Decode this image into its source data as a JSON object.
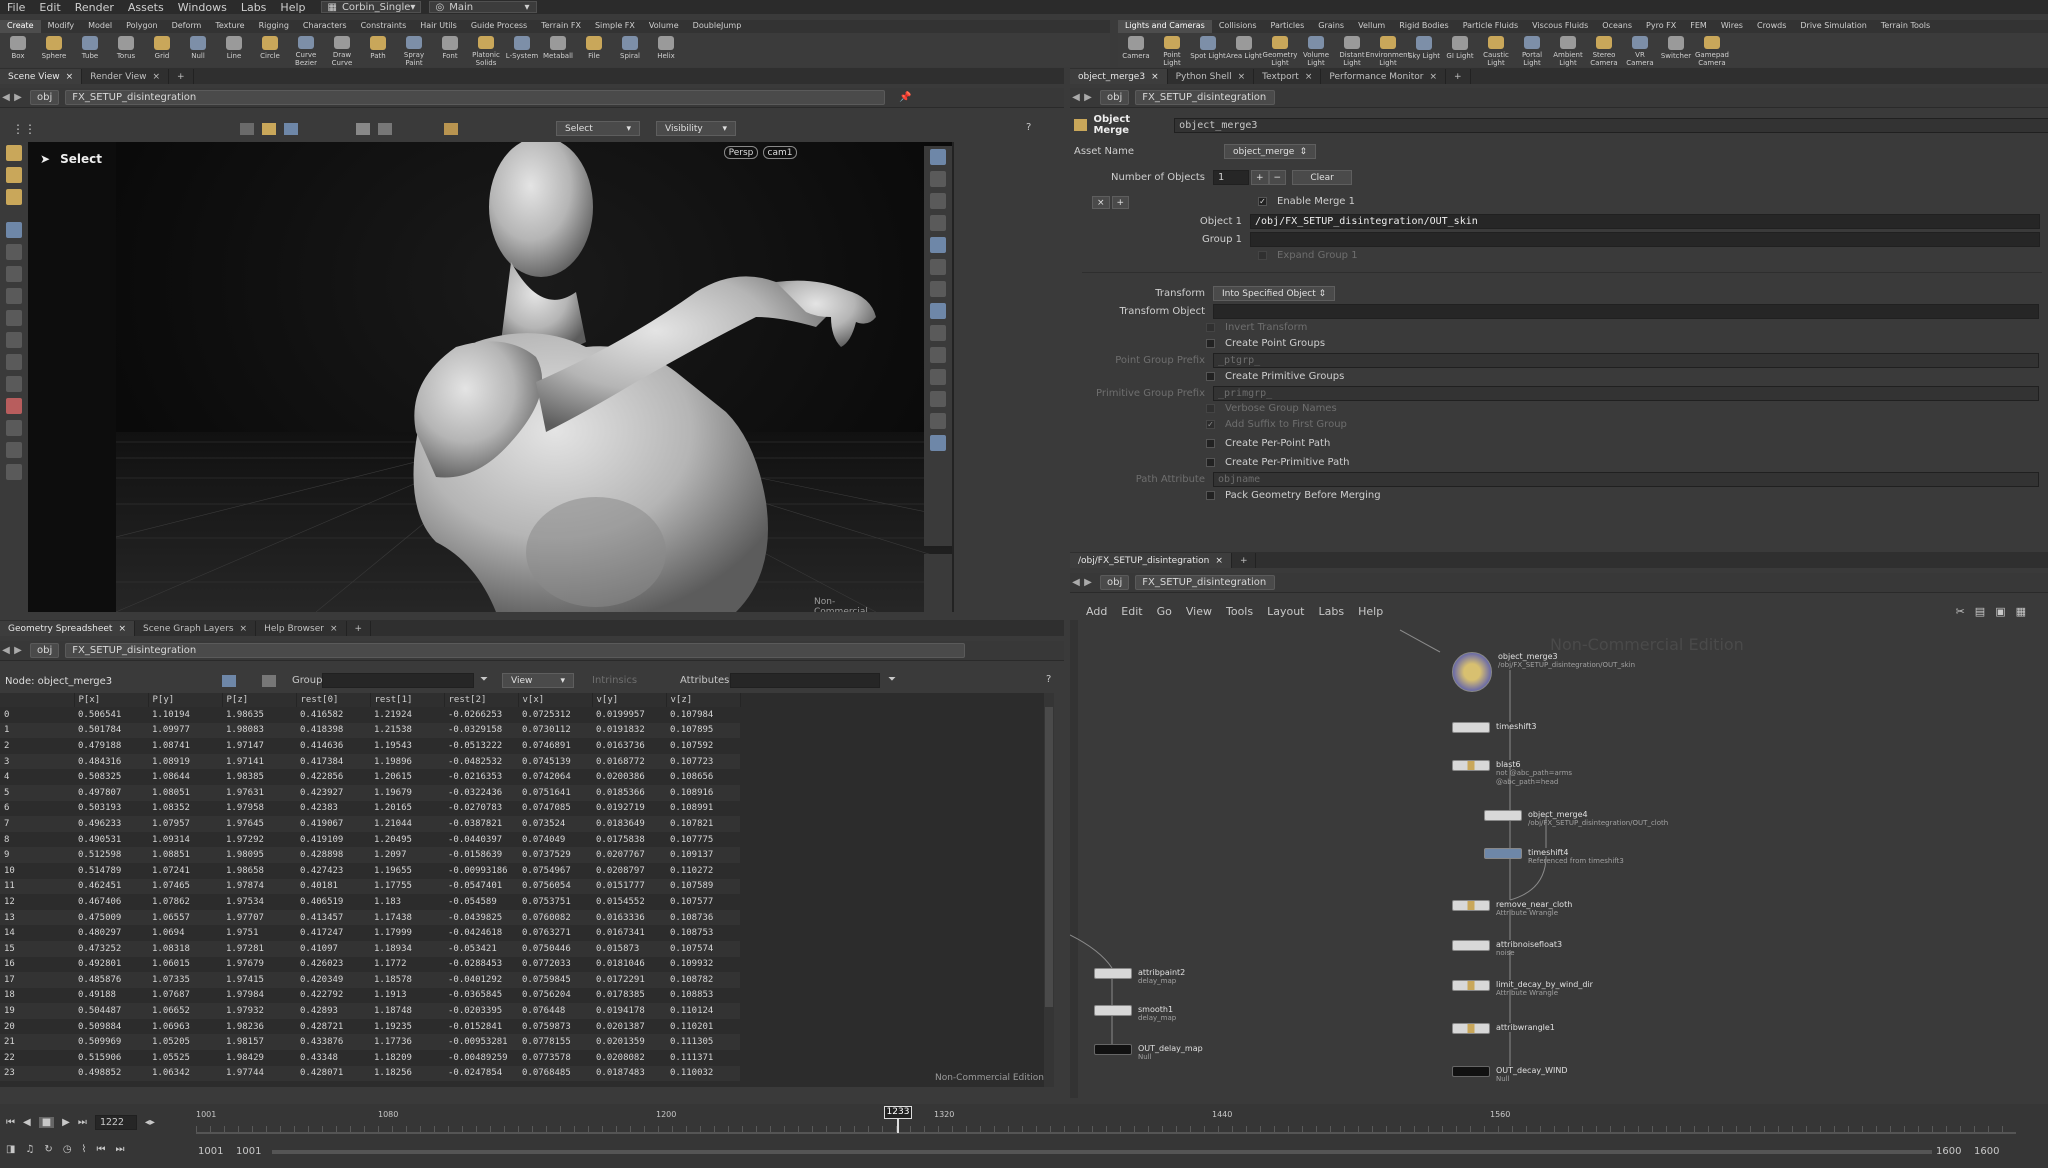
{
  "menubar": {
    "items": [
      "File",
      "Edit",
      "Render",
      "Assets",
      "Windows",
      "Labs",
      "Help"
    ],
    "desktop": "Corbin_Single",
    "context": "Main"
  },
  "shelf_left": {
    "tabs": [
      "Create",
      "Modify",
      "Model",
      "Polygon",
      "Deform",
      "Texture",
      "Rigging",
      "Characters",
      "Constraints",
      "Hair Utils",
      "Guide Process",
      "Terrain FX",
      "Simple FX",
      "Volume",
      "DoubleJump"
    ],
    "tools": [
      "Box",
      "Sphere",
      "Tube",
      "Torus",
      "Grid",
      "Null",
      "Line",
      "Circle",
      "Curve Bezier",
      "Draw Curve",
      "Path",
      "Spray Paint",
      "Font",
      "Platonic Solids",
      "L-System",
      "Metaball",
      "File",
      "Spiral",
      "Helix"
    ]
  },
  "shelf_right": {
    "tabs": [
      "Lights and Cameras",
      "Collisions",
      "Particles",
      "Grains",
      "Vellum",
      "Rigid Bodies",
      "Particle Fluids",
      "Viscous Fluids",
      "Oceans",
      "Pyro FX",
      "FEM",
      "Wires",
      "Crowds",
      "Drive Simulation",
      "Terrain Tools"
    ],
    "tools": [
      "Camera",
      "Point Light",
      "Spot Light",
      "Area Light",
      "Geometry Light",
      "Volume Light",
      "Distant Light",
      "Environment Light",
      "Sky Light",
      "GI Light",
      "Caustic Light",
      "Portal Light",
      "Ambient Light",
      "Stereo Camera",
      "VR Camera",
      "Switcher",
      "Gamepad Camera"
    ]
  },
  "scene_view": {
    "tabs": [
      "Scene View",
      "Render View"
    ],
    "path_root": "obj",
    "path_node": "FX_SETUP_disintegration",
    "select_label": "Select",
    "select_mode": "Select",
    "visibility": "Visibility",
    "persp": "Persp",
    "cam": "cam1",
    "watermark": "Non-Commercial Edition"
  },
  "spreadsheet": {
    "tabs": [
      "Geometry Spreadsheet",
      "Scene Graph Layers",
      "Help Browser"
    ],
    "path_root": "obj",
    "path_node": "FX_SETUP_disintegration",
    "node_label": "Node: object_merge3",
    "group_label": "Group:",
    "view": "View",
    "intrinsics": "Intrinsics",
    "attributes_label": "Attributes:",
    "columns": [
      "",
      "P[x]",
      "P[y]",
      "P[z]",
      "rest[0]",
      "rest[1]",
      "rest[2]",
      "v[x]",
      "v[y]",
      "v[z]"
    ],
    "rows": [
      [
        "0",
        "0.506541",
        "1.10194",
        "1.98635",
        "0.416582",
        "1.21924",
        "-0.0266253",
        "0.0725312",
        "0.0199957",
        "0.107984"
      ],
      [
        "1",
        "0.501784",
        "1.09977",
        "1.98083",
        "0.418398",
        "1.21538",
        "-0.0329158",
        "0.0730112",
        "0.0191832",
        "0.107895"
      ],
      [
        "2",
        "0.479188",
        "1.08741",
        "1.97147",
        "0.414636",
        "1.19543",
        "-0.0513222",
        "0.0746891",
        "0.0163736",
        "0.107592"
      ],
      [
        "3",
        "0.484316",
        "1.08919",
        "1.97141",
        "0.417384",
        "1.19896",
        "-0.0482532",
        "0.0745139",
        "0.0168772",
        "0.107723"
      ],
      [
        "4",
        "0.508325",
        "1.08644",
        "1.98385",
        "0.422856",
        "1.20615",
        "-0.0216353",
        "0.0742064",
        "0.0200386",
        "0.108656"
      ],
      [
        "5",
        "0.497807",
        "1.08051",
        "1.97631",
        "0.423927",
        "1.19679",
        "-0.0322436",
        "0.0751641",
        "0.0185366",
        "0.108916"
      ],
      [
        "6",
        "0.503193",
        "1.08352",
        "1.97958",
        "0.42383",
        "1.20165",
        "-0.0270783",
        "0.0747085",
        "0.0192719",
        "0.108991"
      ],
      [
        "7",
        "0.496233",
        "1.07957",
        "1.97645",
        "0.419067",
        "1.21044",
        "-0.0387821",
        "0.073524",
        "0.0183649",
        "0.107821"
      ],
      [
        "8",
        "0.490531",
        "1.09314",
        "1.97292",
        "0.419109",
        "1.20495",
        "-0.0440397",
        "0.074049",
        "0.0175838",
        "0.107775"
      ],
      [
        "9",
        "0.512598",
        "1.08851",
        "1.98095",
        "0.428898",
        "1.2097",
        "-0.0158639",
        "0.0737529",
        "0.0207767",
        "0.109137"
      ],
      [
        "10",
        "0.514789",
        "1.07241",
        "1.98658",
        "0.427423",
        "1.19655",
        "-0.00993186",
        "0.0754967",
        "0.0208797",
        "0.110272"
      ],
      [
        "11",
        "0.462451",
        "1.07465",
        "1.97874",
        "0.40181",
        "1.17755",
        "-0.0547401",
        "0.0756054",
        "0.0151777",
        "0.107589"
      ],
      [
        "12",
        "0.467406",
        "1.07862",
        "1.97534",
        "0.406519",
        "1.183",
        "-0.054589",
        "0.0753751",
        "0.0154552",
        "0.107577"
      ],
      [
        "13",
        "0.475009",
        "1.06557",
        "1.97707",
        "0.413457",
        "1.17438",
        "-0.0439825",
        "0.0760082",
        "0.0163336",
        "0.108736"
      ],
      [
        "14",
        "0.480297",
        "1.0694",
        "1.9751",
        "0.417247",
        "1.17999",
        "-0.0424618",
        "0.0763271",
        "0.0167341",
        "0.108753"
      ],
      [
        "15",
        "0.473252",
        "1.08318",
        "1.97281",
        "0.41097",
        "1.18934",
        "-0.053421",
        "0.0750446",
        "0.015873",
        "0.107574"
      ],
      [
        "16",
        "0.492801",
        "1.06015",
        "1.97679",
        "0.426023",
        "1.1772",
        "-0.0288453",
        "0.0772033",
        "0.0181046",
        "0.109932"
      ],
      [
        "17",
        "0.485876",
        "1.07335",
        "1.97415",
        "0.420349",
        "1.18578",
        "-0.0401292",
        "0.0759845",
        "0.0172291",
        "0.108782"
      ],
      [
        "18",
        "0.49188",
        "1.07687",
        "1.97984",
        "0.422792",
        "1.1913",
        "-0.0365845",
        "0.0756204",
        "0.0178385",
        "0.108853"
      ],
      [
        "19",
        "0.504487",
        "1.06652",
        "1.97932",
        "0.42893",
        "1.18748",
        "-0.0203395",
        "0.076448",
        "0.0194178",
        "0.110124"
      ],
      [
        "20",
        "0.509884",
        "1.06963",
        "1.98236",
        "0.428721",
        "1.19235",
        "-0.0152841",
        "0.0759873",
        "0.0201387",
        "0.110201"
      ],
      [
        "21",
        "0.509969",
        "1.05205",
        "1.98157",
        "0.433876",
        "1.17736",
        "-0.00953281",
        "0.0778155",
        "0.0201359",
        "0.111305"
      ],
      [
        "22",
        "0.515906",
        "1.05525",
        "1.98429",
        "0.43348",
        "1.18209",
        "-0.00489259",
        "0.0773578",
        "0.0208082",
        "0.111371"
      ],
      [
        "23",
        "0.498852",
        "1.06342",
        "1.97744",
        "0.428071",
        "1.18256",
        "-0.0247854",
        "0.0768485",
        "0.0187483",
        "0.110032"
      ]
    ],
    "watermark": "Non-Commercial Edition"
  },
  "params": {
    "tabs": [
      "object_merge3",
      "Python Shell",
      "Textport",
      "Performance Monitor"
    ],
    "path_root": "obj",
    "path_node": "FX_SETUP_disintegration",
    "op_type": "Object Merge",
    "op_name": "object_merge3",
    "asset_name_label": "Asset Name",
    "asset_name": "object_merge",
    "num_objects_label": "Number of Objects",
    "num_objects": "1",
    "clear": "Clear",
    "enable_merge": "Enable Merge 1",
    "object1_label": "Object 1",
    "object1": "/obj/FX_SETUP_disintegration/OUT_skin",
    "group1_label": "Group 1",
    "expand_group": "Expand Group 1",
    "transform_label": "Transform",
    "transform": "Into Specified Object",
    "transform_object_label": "Transform Object",
    "invert_transform": "Invert Transform",
    "create_point_groups": "Create Point Groups",
    "point_group_prefix_label": "Point Group Prefix",
    "point_group_prefix": "_ptgrp_",
    "create_prim_groups": "Create Primitive Groups",
    "prim_group_prefix_label": "Primitive Group Prefix",
    "prim_group_prefix": "_primgrp_",
    "verbose_group_names": "Verbose Group Names",
    "add_suffix": "Add Suffix to First Group",
    "per_point_path": "Create Per-Point Path",
    "per_prim_path": "Create Per-Primitive Path",
    "path_attribute_label": "Path Attribute",
    "path_attribute": "objname",
    "pack_geometry": "Pack Geometry Before Merging"
  },
  "network": {
    "tab": "/obj/FX_SETUP_disintegration",
    "path_root": "obj",
    "path_node": "FX_SETUP_disintegration",
    "menu": [
      "Add",
      "Edit",
      "Go",
      "View",
      "Tools",
      "Layout",
      "Labs",
      "Help"
    ],
    "watermark": "Non-Commercial Edition",
    "nodes": [
      {
        "name": "object_merge3",
        "sub": "/obj/FX_SETUP_disintegration/OUT_skin"
      },
      {
        "name": "timeshift3",
        "sub": ""
      },
      {
        "name": "blast6",
        "sub": "not @abc_path=arms @abc_path=head"
      },
      {
        "name": "object_merge4",
        "sub": "/obj/FX_SETUP_disintegration/OUT_cloth"
      },
      {
        "name": "timeshift4",
        "sub": "Referenced from timeshift3"
      },
      {
        "name": "remove_near_cloth",
        "sub": "Attribute Wrangle"
      },
      {
        "name": "attribnoisefloat3",
        "sub": "noise"
      },
      {
        "name": "limit_decay_by_wind_dir",
        "sub": "Attribute Wrangle"
      },
      {
        "name": "attribwrangle1",
        "sub": ""
      },
      {
        "name": "OUT_decay_WIND",
        "sub": "Null"
      },
      {
        "name": "attribpaint2",
        "sub": "delay_map"
      },
      {
        "name": "smooth1",
        "sub": "delay_map"
      },
      {
        "name": "OUT_delay_map",
        "sub": "Null"
      }
    ]
  },
  "timeline": {
    "frame": "1222",
    "current": "1233",
    "ticks": [
      "1001",
      "1080",
      "1200",
      "1320",
      "1440",
      "1560"
    ],
    "start": "1001",
    "start2": "1001",
    "end": "1600",
    "end2": "1600"
  }
}
